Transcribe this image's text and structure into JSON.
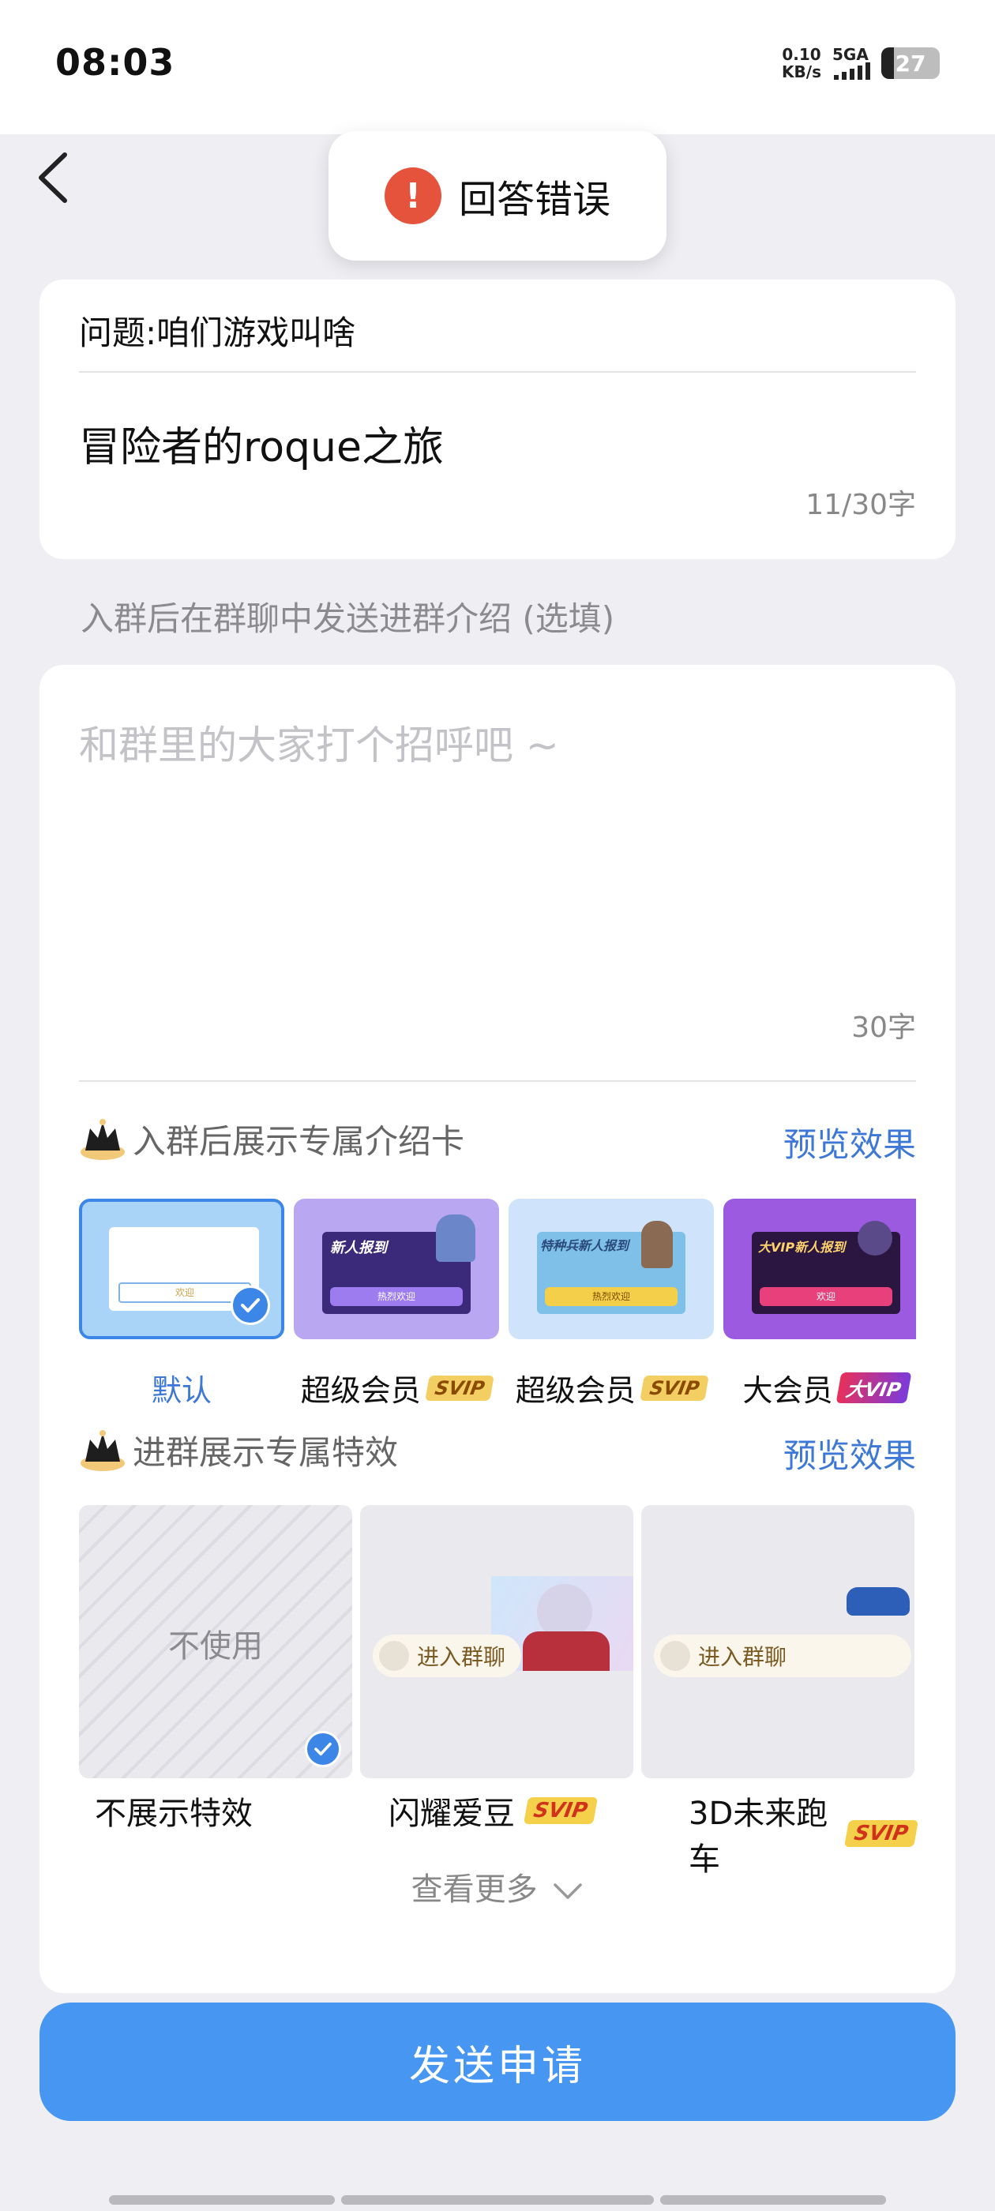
{
  "status_bar": {
    "time": "08:03",
    "net_speed_value": "0.10",
    "net_speed_unit": "KB/s",
    "network_type": "5GA",
    "battery_level": "27"
  },
  "toast": {
    "icon": "exclamation-icon",
    "text": "回答错误"
  },
  "question_card": {
    "question": "问题:咱们游戏叫啥",
    "answer": "冒险者的roque之旅",
    "count": "11/30字"
  },
  "intro_hint": "入群后在群聊中发送进群介绍 (选填)",
  "intro_card": {
    "placeholder": "和群里的大家打个招呼吧 ~",
    "count": "30字",
    "card_section": {
      "title": "入群后展示专属介绍卡",
      "preview": "预览效果",
      "options": [
        {
          "label": "默认",
          "badge": "",
          "art_text": "欢迎",
          "selected": true
        },
        {
          "label": "超级会员",
          "badge": "SVIP",
          "art_text": "新人报到",
          "sub_text": "热烈欢迎"
        },
        {
          "label": "超级会员",
          "badge": "SVIP",
          "art_text": "特种兵新人报到",
          "sub_text": "热烈欢迎"
        },
        {
          "label": "大会员",
          "badge": "大VIP",
          "art_text": "大VIP新人报到",
          "sub_text": "欢迎"
        }
      ]
    },
    "effect_section": {
      "title": "进群展示专属特效",
      "preview": "预览效果",
      "options": [
        {
          "label": "不展示特效",
          "center_text": "不使用",
          "badge": "",
          "selected": true
        },
        {
          "label": "闪耀爱豆",
          "pill_text": "进入群聊",
          "badge": "SVIP"
        },
        {
          "label": "3D未来跑车",
          "pill_text": "进入群聊",
          "badge": "SVIP"
        }
      ]
    },
    "see_more": "查看更多"
  },
  "send_button": "发送申请",
  "colors": {
    "accent": "#4696f2",
    "link": "#3d78d6",
    "error": "#e5533c",
    "background": "#eeeef3"
  }
}
